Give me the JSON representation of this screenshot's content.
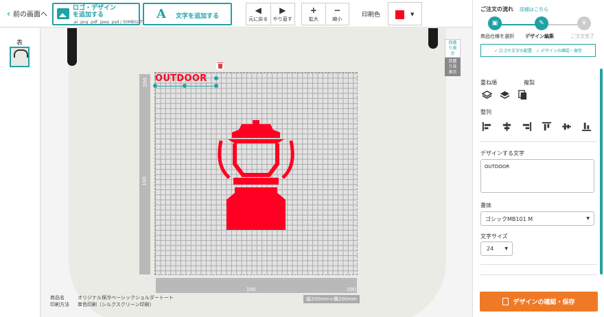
{
  "toolbar": {
    "back_label": "前の画面へ",
    "upload_label": "ロゴ・デザインを追加する",
    "upload_hint": ".ai .png .pdf .jpeg .psd / 50MB以下",
    "add_text_label": "文字を追加する",
    "undo_label": "元に戻る",
    "redo_label": "やり直す",
    "zoom_in_label": "拡大",
    "zoom_out_label": "縮小",
    "print_color_label": "印刷色",
    "print_color": "#ff0022"
  },
  "thumbs": {
    "face_label": "表"
  },
  "canvas": {
    "show_grid_label": "目盛り表示",
    "hide_grid_label": "目盛り非表示",
    "ruler_v_200": "200",
    "ruler_v_100": "100",
    "ruler_h_100": "100",
    "ruler_h_200": "200",
    "size_label": "縦200mm×横200mm",
    "selected_text": "OUTDOOR",
    "design_color": "#ff0022"
  },
  "product": {
    "name_key": "商品名",
    "name_value": "オリジナル保冷ベーシックショルダートート",
    "method_key": "印刷方法",
    "method_value": "単色印刷（シルクスクリーン印刷）"
  },
  "panel": {
    "flow_title": "ご注文の流れ",
    "flow_link": "詳細はこちら",
    "steps": [
      {
        "label": "商品仕様を選択"
      },
      {
        "label": "デザイン編集"
      },
      {
        "label": "ご注文完了"
      }
    ],
    "check1": "✓ ロゴや文字の配置",
    "check2": "✓ デザインの確認・保存",
    "order_label": "重ね順",
    "duplicate_label": "複製",
    "align_label": "整列",
    "text_label": "デザインする文字",
    "text_value": "OUTDOOR",
    "font_label": "書体",
    "font_value": "ゴシックMB101 M",
    "size_label": "文字サイズ",
    "size_value": "24",
    "confirm_label": "デザインの確認・保存",
    "accent_color": "#1fa2a7",
    "cta_color": "#ef7a26"
  }
}
